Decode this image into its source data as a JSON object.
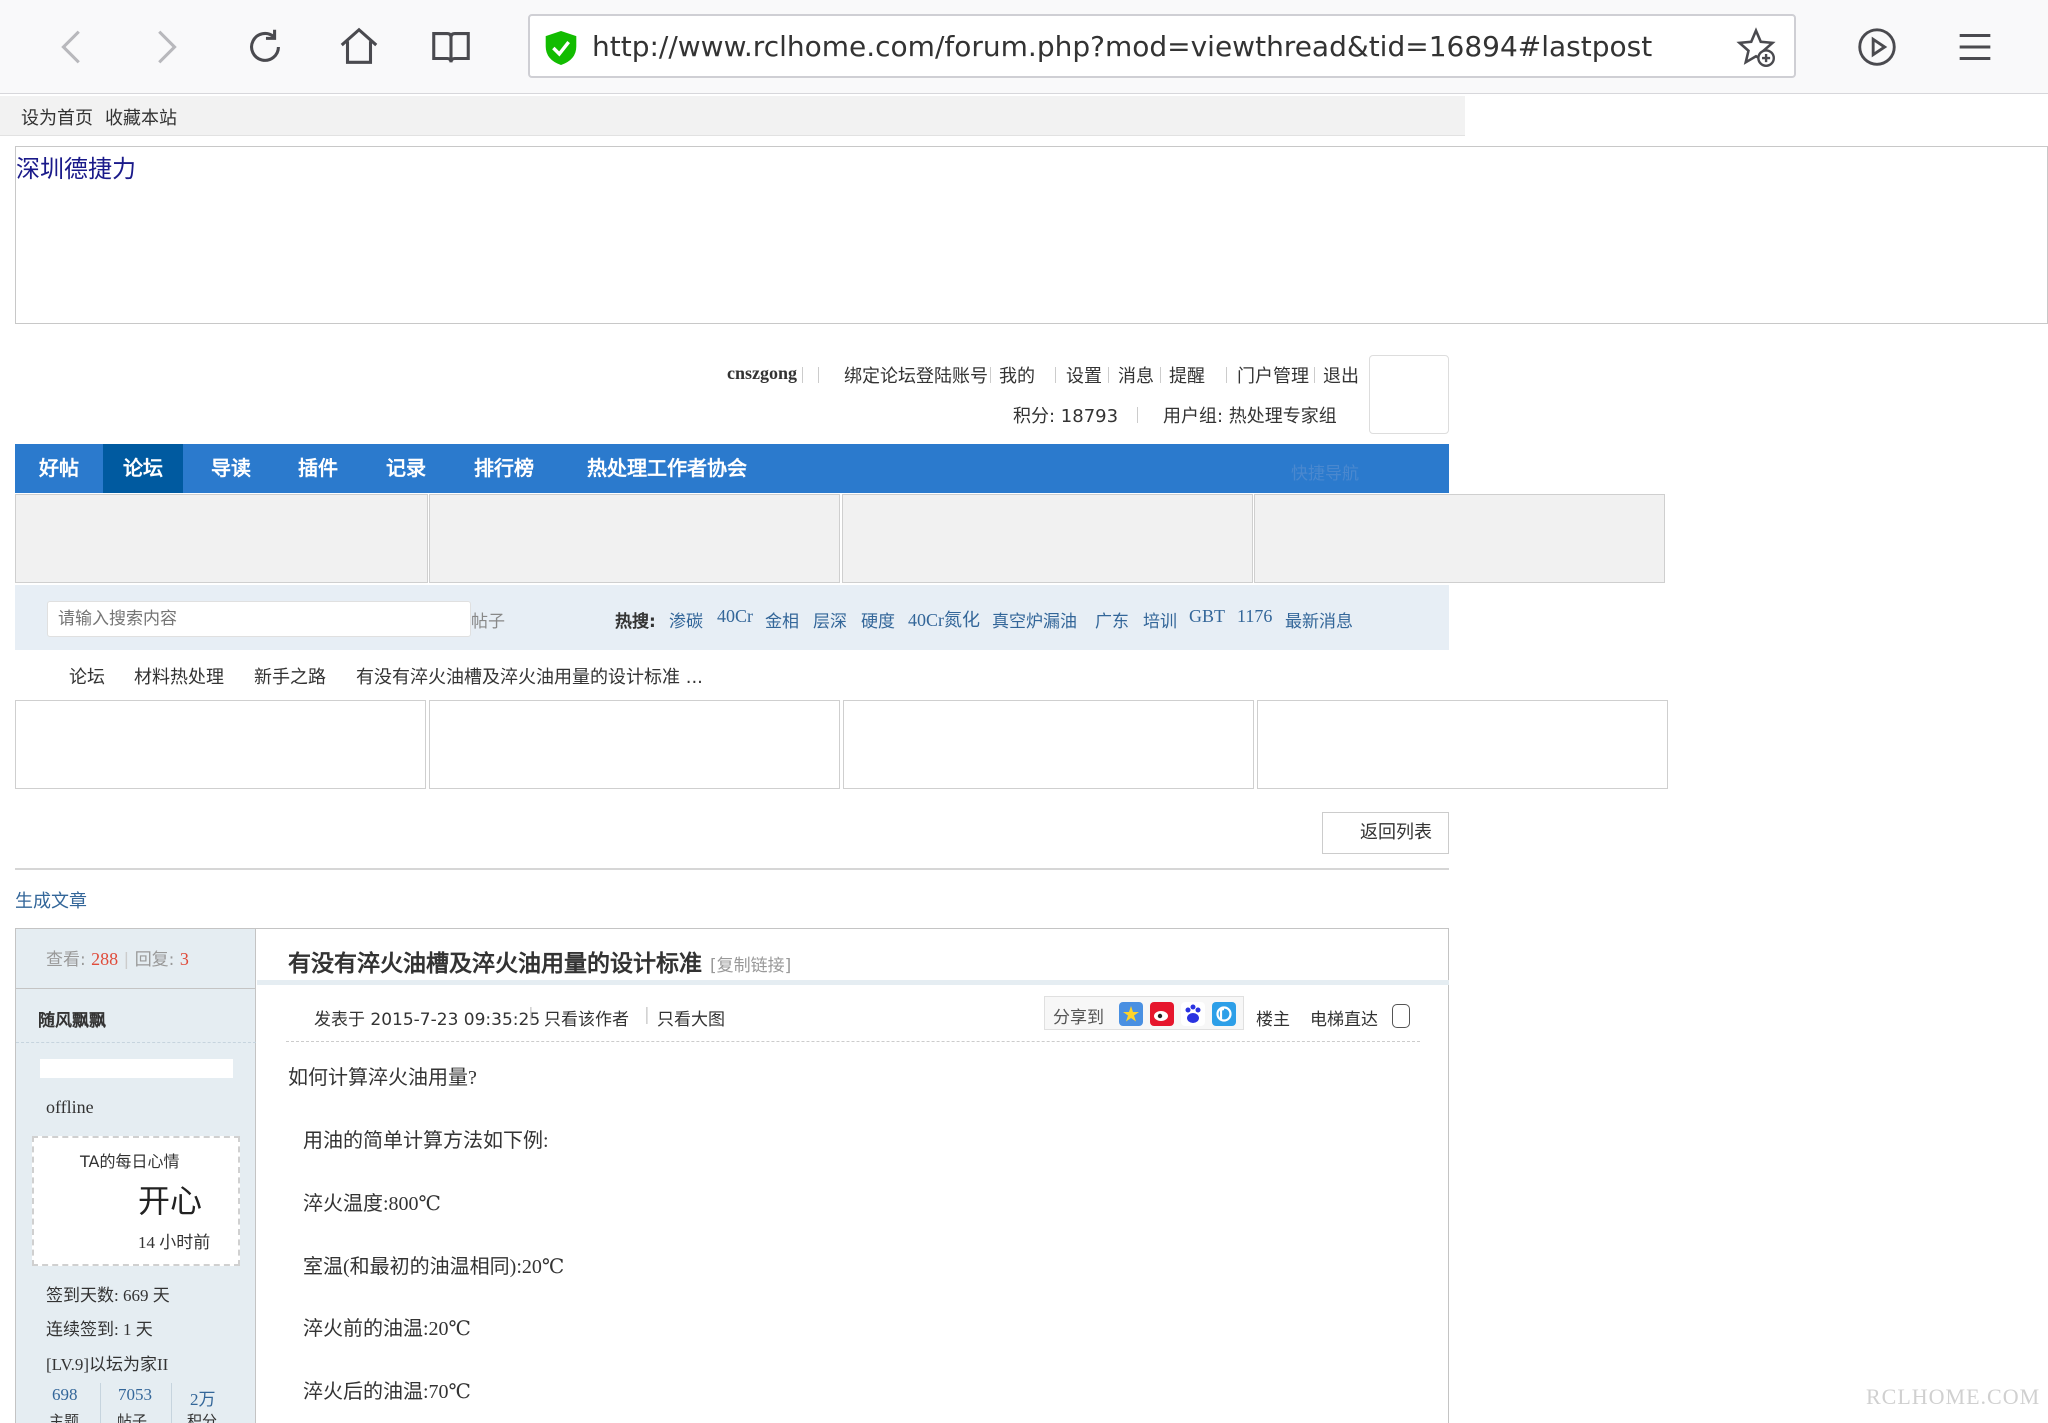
{
  "browser": {
    "url": "http://www.rclhome.com/forum.php?mod=viewthread&tid=16894#lastpost"
  },
  "top_links": {
    "set_home": "设为首页",
    "bookmark_site": "收藏本站"
  },
  "banner": {
    "site_title": "深圳德捷力"
  },
  "user_bar": {
    "username": "cnszgong",
    "bind_account": "绑定论坛登陆账号",
    "mine": "我的",
    "settings": "设置",
    "messages": "消息",
    "reminders": "提醒",
    "portal_admin": "门户管理",
    "logout": "退出",
    "points": "积分: 18793",
    "user_group": "用户组: 热处理专家组"
  },
  "main_nav": {
    "items": [
      "好帖",
      "论坛",
      "导读",
      "插件",
      "记录",
      "排行榜",
      "热处理工作者协会"
    ],
    "active_index": 1,
    "quick_nav": "快捷导航"
  },
  "search": {
    "placeholder": "请输入搜索内容",
    "type": "帖子",
    "hot_label": "热搜:",
    "hot_terms": [
      "渗碳",
      "40Cr",
      "金相",
      "层深",
      "硬度",
      "40Cr氮化",
      "真空炉漏油",
      "广东",
      "培训",
      "GBT",
      "1176",
      "最新消息"
    ]
  },
  "breadcrumb": [
    "论坛",
    "材料热处理",
    "新手之路",
    "有没有淬火油槽及淬火油用量的设计标准 ..."
  ],
  "back_to_list": "返回列表",
  "generate_article": "生成文章",
  "thread": {
    "views_label": "查看:",
    "views": "288",
    "replies_label": "回复:",
    "replies": "3",
    "title": "有没有淬火油槽及淬火油用量的设计标准",
    "copy_link": "[复制链接]",
    "author": {
      "name": "随风飘飘",
      "status": "offline",
      "mood_label": "TA的每日心情",
      "mood": "开心",
      "mood_time": "14 小时前",
      "checkin_days": "签到天数: 669 天",
      "checkin_streak": "连续签到: 1 天",
      "level": "[LV.9]以坛为家II",
      "topics": "698",
      "topics_label": "主题",
      "posts": "7053",
      "posts_label": "帖子",
      "score": "2万",
      "score_label": "积分"
    },
    "post_time": "发表于 2015-7-23 09:35:25",
    "only_author": "只看该作者",
    "only_images": "只看大图",
    "share_to": "分享到",
    "floor": "楼主",
    "elevator": "电梯直达",
    "content": [
      "如何计算淬火油用量?",
      "用油的简单计算方法如下例:",
      "淬火温度:800℃",
      "室温(和最初的油温相同):20℃",
      "淬火前的油温:20℃",
      "淬火后的油温:70℃"
    ]
  },
  "watermark": "RCLHOME.COM",
  "colors": {
    "nav_blue": "#2b7acd",
    "nav_active": "#005aa0",
    "link_blue": "#336699",
    "count_red": "#e04b3a"
  }
}
